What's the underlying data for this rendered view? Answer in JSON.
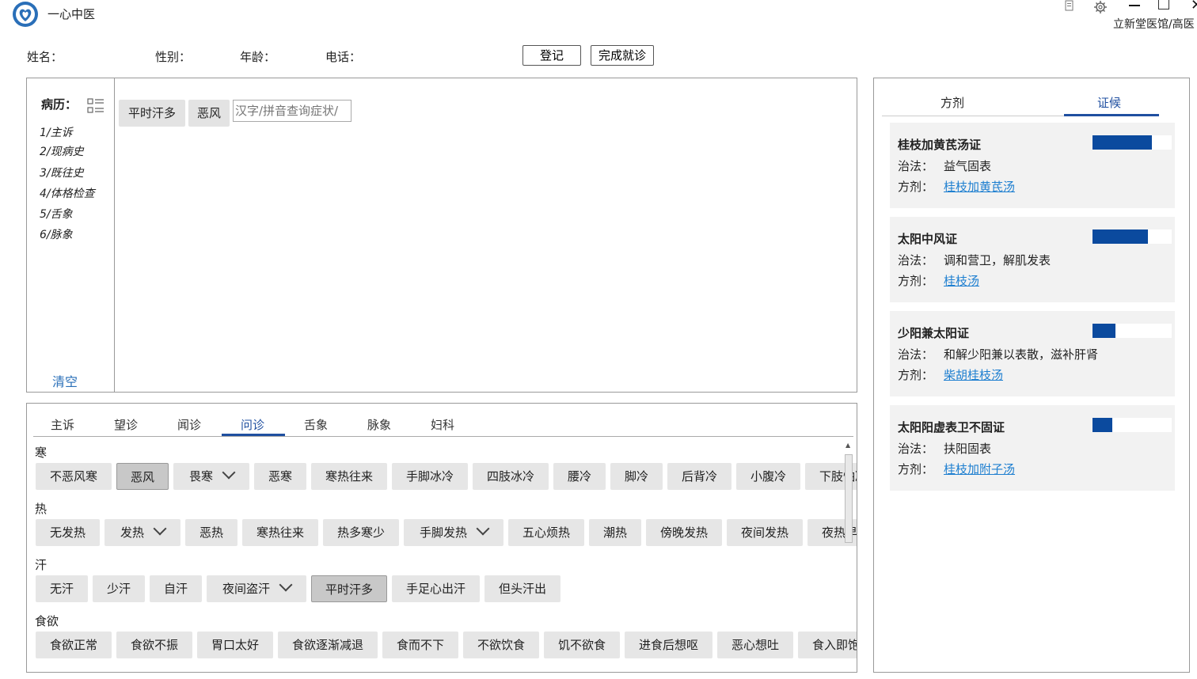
{
  "app": {
    "title": "一心中医",
    "clinic": "立新堂医馆/高医",
    "logo": "heart-hands-logo",
    "window_icons": [
      "copy-icon",
      "gear-icon",
      "minimize-icon",
      "maximize-icon",
      "close-icon"
    ]
  },
  "patient": {
    "name_label": "姓名：",
    "gender_label": "性别：",
    "age_label": "年龄：",
    "phone_label": "电话：",
    "register_button": "登记",
    "finish_button": "完成就诊"
  },
  "record": {
    "title": "病历：",
    "sections": [
      "1/主诉",
      "2/现病史",
      "3/既往史",
      "4/体格检查",
      "5/舌象",
      "6/脉象"
    ],
    "clear_label": "清空",
    "selected_symptoms": [
      "平时汗多",
      "恶风"
    ],
    "search_placeholder": "汉字/拼音查询症状/"
  },
  "diagnosis": {
    "tabs": [
      "主诉",
      "望诊",
      "闻诊",
      "问诊",
      "舌象",
      "脉象",
      "妇科"
    ],
    "active_tab": "问诊",
    "categories": [
      {
        "name": "寒",
        "buttons": [
          {
            "label": "不恶风寒"
          },
          {
            "label": "恶风",
            "selected": true
          },
          {
            "label": "畏寒",
            "dropdown": true
          },
          {
            "label": "恶寒"
          },
          {
            "label": "寒热往来"
          },
          {
            "label": "手脚冰冷"
          },
          {
            "label": "四肢冰冷"
          },
          {
            "label": "腰冷"
          },
          {
            "label": "脚冷"
          },
          {
            "label": "后背冷"
          },
          {
            "label": "小腹冷"
          },
          {
            "label": "下肢怕冷"
          }
        ]
      },
      {
        "name": "热",
        "buttons": [
          {
            "label": "无发热"
          },
          {
            "label": "发热",
            "dropdown": true
          },
          {
            "label": "恶热"
          },
          {
            "label": "寒热往来"
          },
          {
            "label": "热多寒少"
          },
          {
            "label": "手脚发热",
            "dropdown": true
          },
          {
            "label": "五心烦热"
          },
          {
            "label": "潮热"
          },
          {
            "label": "傍晚发热"
          },
          {
            "label": "夜间发热"
          },
          {
            "label": "夜热早凉"
          }
        ]
      },
      {
        "name": "汗",
        "buttons": [
          {
            "label": "无汗"
          },
          {
            "label": "少汗"
          },
          {
            "label": "自汗"
          },
          {
            "label": "夜间盗汗",
            "dropdown": true
          },
          {
            "label": "平时汗多",
            "selected": true
          },
          {
            "label": "手足心出汗"
          },
          {
            "label": "但头汗出"
          }
        ]
      },
      {
        "name": "食欲",
        "buttons": [
          {
            "label": "食欲正常"
          },
          {
            "label": "食欲不振"
          },
          {
            "label": "胃口太好"
          },
          {
            "label": "食欲逐渐减退"
          },
          {
            "label": "食而不下"
          },
          {
            "label": "不欲饮食"
          },
          {
            "label": "饥不欲食"
          },
          {
            "label": "进食后想呕"
          },
          {
            "label": "恶心想吐"
          },
          {
            "label": "食入即饱"
          }
        ]
      }
    ]
  },
  "results": {
    "tabs": [
      "方剂",
      "证候"
    ],
    "active_tab": "证候",
    "treatment_label": "治法：",
    "formula_label": "方剂：",
    "cards": [
      {
        "name": "桂枝加黄芪汤证",
        "treatment": "益气固表",
        "formula": "桂枝加黄芪汤",
        "score": 0.75
      },
      {
        "name": "太阳中风证",
        "treatment": "调和营卫，解肌发表",
        "formula": "桂枝汤",
        "score": 0.7
      },
      {
        "name": "少阳兼太阳证",
        "treatment": "和解少阳兼以表散，滋补肝肾",
        "formula": "柴胡桂枝汤",
        "score": 0.29
      },
      {
        "name": "太阳阳虚表卫不固证",
        "treatment": "扶阳固表",
        "formula": "桂枝加附子汤",
        "score": 0.25
      }
    ],
    "accent_color": "#0b4a9e",
    "link_color": "#1e7fd0"
  }
}
